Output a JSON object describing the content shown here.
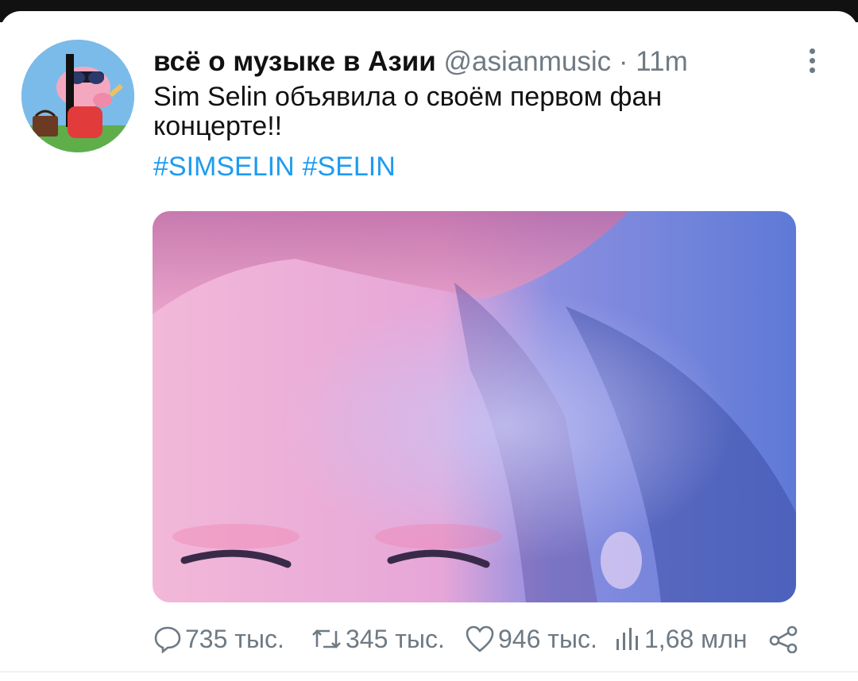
{
  "tweet": {
    "display_name": "всё о музыке в Азии",
    "handle": "@asianmusic",
    "separator": " · ",
    "time": "11m",
    "text": "Sim Selin объявила о своём первом фан концерте!!",
    "hashtags": [
      "#SIMSELIN",
      "#SELIN"
    ]
  },
  "actions": {
    "replies": "735 тыс.",
    "retweets": "345 тыс.",
    "likes": "946 тыс.",
    "views": "1,68 млн"
  },
  "icons": {
    "more": "more-vertical-icon",
    "reply": "reply-icon",
    "retweet": "retweet-icon",
    "like": "heart-icon",
    "views": "views-chart-icon",
    "share": "share-icon"
  },
  "colors": {
    "hashtag": "#1d9bf0",
    "muted": "#6e7a84",
    "text": "#111111"
  }
}
